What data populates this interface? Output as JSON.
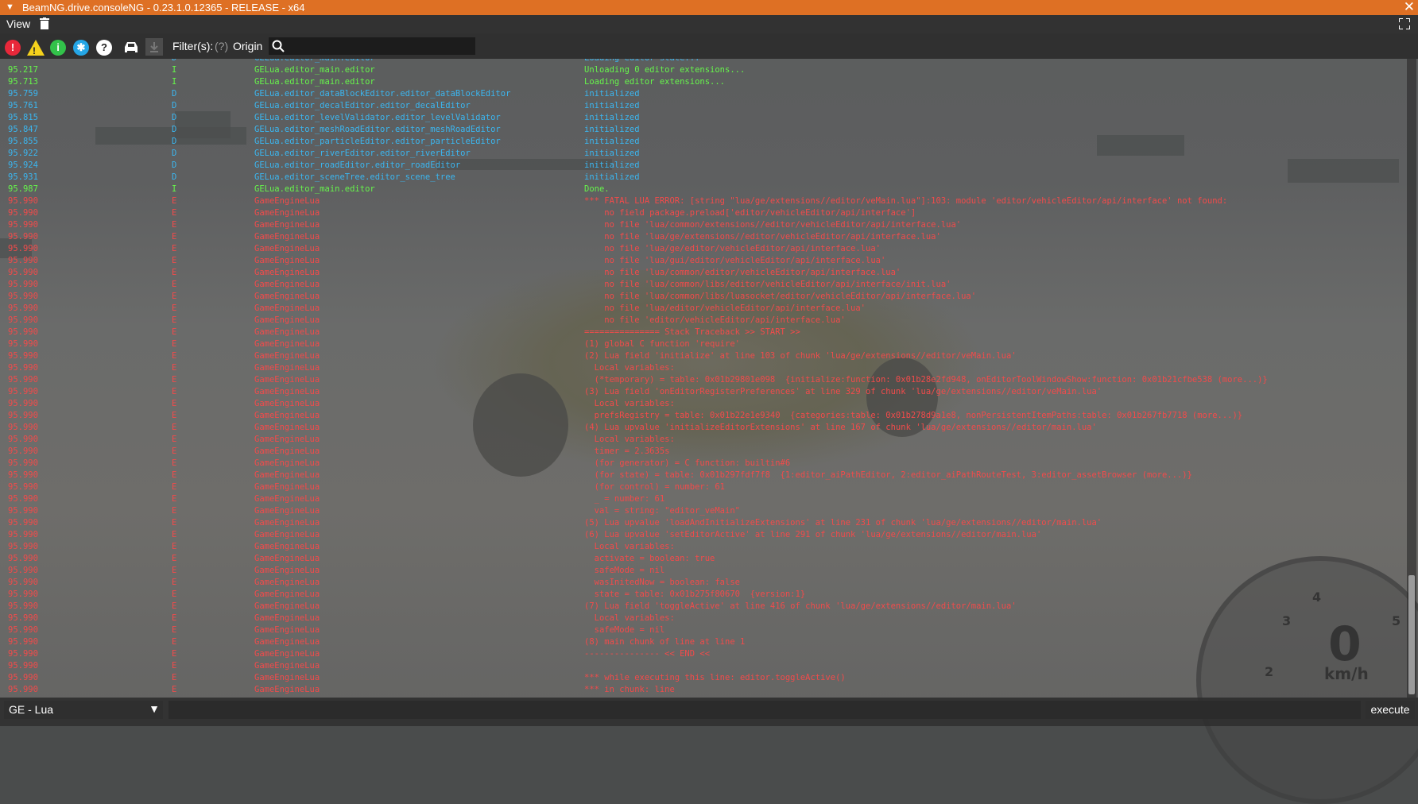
{
  "window": {
    "title": "BeamNG.drive.consoleNG - 0.23.1.0.12365 - RELEASE - x64"
  },
  "menu": {
    "view_label": "View"
  },
  "toolbar": {
    "filter_label": "Filter(s):",
    "filter_hint": "(?)",
    "origin_label": "Origin",
    "search_value": ""
  },
  "gauge": {
    "numbers": [
      "4",
      "3",
      "5",
      "2"
    ],
    "speed": "0",
    "unit": "km/h"
  },
  "log": {
    "rows": [
      {
        "t": "",
        "l": "D",
        "o": "GELua.editor_main.editor",
        "m": "Loading editor state..."
      },
      {
        "t": "95.217",
        "l": "I",
        "o": "GELua.editor_main.editor",
        "m": "Unloading 0 editor extensions..."
      },
      {
        "t": "95.713",
        "l": "I",
        "o": "GELua.editor_main.editor",
        "m": "Loading editor extensions..."
      },
      {
        "t": "95.759",
        "l": "D",
        "o": "GELua.editor_dataBlockEditor.editor_dataBlockEditor",
        "m": "initialized"
      },
      {
        "t": "95.761",
        "l": "D",
        "o": "GELua.editor_decalEditor.editor_decalEditor",
        "m": "initialized"
      },
      {
        "t": "95.815",
        "l": "D",
        "o": "GELua.editor_levelValidator.editor_levelValidator",
        "m": "initialized"
      },
      {
        "t": "95.847",
        "l": "D",
        "o": "GELua.editor_meshRoadEditor.editor_meshRoadEditor",
        "m": "initialized"
      },
      {
        "t": "95.855",
        "l": "D",
        "o": "GELua.editor_particleEditor.editor_particleEditor",
        "m": "initialized"
      },
      {
        "t": "95.922",
        "l": "D",
        "o": "GELua.editor_riverEditor.editor_riverEditor",
        "m": "initialized"
      },
      {
        "t": "95.924",
        "l": "D",
        "o": "GELua.editor_roadEditor.editor_roadEditor",
        "m": "initialized"
      },
      {
        "t": "95.931",
        "l": "D",
        "o": "GELua.editor_sceneTree.editor_scene_tree",
        "m": "initialized"
      },
      {
        "t": "95.987",
        "l": "I",
        "o": "GELua.editor_main.editor",
        "m": "Done."
      },
      {
        "t": "95.990",
        "l": "E",
        "o": "GameEngineLua",
        "m": "*** FATAL LUA ERROR: [string \"lua/ge/extensions//editor/veMain.lua\"]:103: module 'editor/vehicleEditor/api/interface' not found:"
      },
      {
        "t": "95.990",
        "l": "E",
        "o": "GameEngineLua",
        "m": "    no field package.preload['editor/vehicleEditor/api/interface']"
      },
      {
        "t": "95.990",
        "l": "E",
        "o": "GameEngineLua",
        "m": "    no file 'lua/common/extensions//editor/vehicleEditor/api/interface.lua'"
      },
      {
        "t": "95.990",
        "l": "E",
        "o": "GameEngineLua",
        "m": "    no file 'lua/ge/extensions//editor/vehicleEditor/api/interface.lua'"
      },
      {
        "t": "95.990",
        "l": "E",
        "o": "GameEngineLua",
        "m": "    no file 'lua/ge/editor/vehicleEditor/api/interface.lua'"
      },
      {
        "t": "95.990",
        "l": "E",
        "o": "GameEngineLua",
        "m": "    no file 'lua/gui/editor/vehicleEditor/api/interface.lua'"
      },
      {
        "t": "95.990",
        "l": "E",
        "o": "GameEngineLua",
        "m": "    no file 'lua/common/editor/vehicleEditor/api/interface.lua'"
      },
      {
        "t": "95.990",
        "l": "E",
        "o": "GameEngineLua",
        "m": "    no file 'lua/common/libs/editor/vehicleEditor/api/interface/init.lua'"
      },
      {
        "t": "95.990",
        "l": "E",
        "o": "GameEngineLua",
        "m": "    no file 'lua/common/libs/luasocket/editor/vehicleEditor/api/interface.lua'"
      },
      {
        "t": "95.990",
        "l": "E",
        "o": "GameEngineLua",
        "m": "    no file 'lua/editor/vehicleEditor/api/interface.lua'"
      },
      {
        "t": "95.990",
        "l": "E",
        "o": "GameEngineLua",
        "m": "    no file 'editor/vehicleEditor/api/interface.lua'"
      },
      {
        "t": "95.990",
        "l": "E",
        "o": "GameEngineLua",
        "m": "=============== Stack Traceback >> START >>"
      },
      {
        "t": "95.990",
        "l": "E",
        "o": "GameEngineLua",
        "m": "(1) global C function 'require'"
      },
      {
        "t": "95.990",
        "l": "E",
        "o": "GameEngineLua",
        "m": "(2) Lua field 'initialize' at line 103 of chunk 'lua/ge/extensions//editor/veMain.lua'"
      },
      {
        "t": "95.990",
        "l": "E",
        "o": "GameEngineLua",
        "m": "  Local variables:"
      },
      {
        "t": "95.990",
        "l": "E",
        "o": "GameEngineLua",
        "m": "  (*temporary) = table: 0x01b29801e098  {initialize:function: 0x01b28e2fd948, onEditorToolWindowShow:function: 0x01b21cfbe538 (more...)}"
      },
      {
        "t": "95.990",
        "l": "E",
        "o": "GameEngineLua",
        "m": "(3) Lua field 'onEditorRegisterPreferences' at line 329 of chunk 'lua/ge/extensions//editor/veMain.lua'"
      },
      {
        "t": "95.990",
        "l": "E",
        "o": "GameEngineLua",
        "m": "  Local variables:"
      },
      {
        "t": "95.990",
        "l": "E",
        "o": "GameEngineLua",
        "m": "  prefsRegistry = table: 0x01b22e1e9340  {categories:table: 0x01b278d9a1e8, nonPersistentItemPaths:table: 0x01b267fb7718 (more...)}"
      },
      {
        "t": "95.990",
        "l": "E",
        "o": "GameEngineLua",
        "m": "(4) Lua upvalue 'initializeEditorExtensions' at line 167 of chunk 'lua/ge/extensions//editor/main.lua'"
      },
      {
        "t": "95.990",
        "l": "E",
        "o": "GameEngineLua",
        "m": "  Local variables:"
      },
      {
        "t": "95.990",
        "l": "E",
        "o": "GameEngineLua",
        "m": "  timer = 2.3635s"
      },
      {
        "t": "95.990",
        "l": "E",
        "o": "GameEngineLua",
        "m": "  (for generator) = C function: builtin#6"
      },
      {
        "t": "95.990",
        "l": "E",
        "o": "GameEngineLua",
        "m": "  (for state) = table: 0x01b297fdf7f8  {1:editor_aiPathEditor, 2:editor_aiPathRouteTest, 3:editor_assetBrowser (more...)}"
      },
      {
        "t": "95.990",
        "l": "E",
        "o": "GameEngineLua",
        "m": "  (for control) = number: 61"
      },
      {
        "t": "95.990",
        "l": "E",
        "o": "GameEngineLua",
        "m": "  _ = number: 61"
      },
      {
        "t": "95.990",
        "l": "E",
        "o": "GameEngineLua",
        "m": "  val = string: \"editor_veMain\""
      },
      {
        "t": "95.990",
        "l": "E",
        "o": "GameEngineLua",
        "m": "(5) Lua upvalue 'loadAndInitializeExtensions' at line 231 of chunk 'lua/ge/extensions//editor/main.lua'"
      },
      {
        "t": "95.990",
        "l": "E",
        "o": "GameEngineLua",
        "m": "(6) Lua upvalue 'setEditorActive' at line 291 of chunk 'lua/ge/extensions//editor/main.lua'"
      },
      {
        "t": "95.990",
        "l": "E",
        "o": "GameEngineLua",
        "m": "  Local variables:"
      },
      {
        "t": "95.990",
        "l": "E",
        "o": "GameEngineLua",
        "m": "  activate = boolean: true"
      },
      {
        "t": "95.990",
        "l": "E",
        "o": "GameEngineLua",
        "m": "  safeMode = nil"
      },
      {
        "t": "95.990",
        "l": "E",
        "o": "GameEngineLua",
        "m": "  wasInitedNow = boolean: false"
      },
      {
        "t": "95.990",
        "l": "E",
        "o": "GameEngineLua",
        "m": "  state = table: 0x01b275f80670  {version:1}"
      },
      {
        "t": "95.990",
        "l": "E",
        "o": "GameEngineLua",
        "m": "(7) Lua field 'toggleActive' at line 416 of chunk 'lua/ge/extensions//editor/main.lua'"
      },
      {
        "t": "95.990",
        "l": "E",
        "o": "GameEngineLua",
        "m": "  Local variables:"
      },
      {
        "t": "95.990",
        "l": "E",
        "o": "GameEngineLua",
        "m": "  safeMode = nil"
      },
      {
        "t": "95.990",
        "l": "E",
        "o": "GameEngineLua",
        "m": "(8) main chunk of line at line 1"
      },
      {
        "t": "95.990",
        "l": "E",
        "o": "GameEngineLua",
        "m": "--------------- << END <<"
      },
      {
        "t": "95.990",
        "l": "E",
        "o": "GameEngineLua",
        "m": ""
      },
      {
        "t": "95.990",
        "l": "E",
        "o": "GameEngineLua",
        "m": "*** while executing this line: editor.toggleActive()"
      },
      {
        "t": "95.990",
        "l": "E",
        "o": "GameEngineLua",
        "m": "*** in chunk: line"
      }
    ]
  },
  "bottom": {
    "context_label": "GE - Lua",
    "command_value": "",
    "execute_label": "execute"
  },
  "colors": {
    "titlebar": "#de7024",
    "debug": "#3bb6f0",
    "info": "#66f54b",
    "error": "#f24b4b"
  },
  "icons": [
    "menu-triangle-icon",
    "close-icon",
    "trash-icon",
    "fullscreen-icon",
    "error-filter-icon",
    "warning-filter-icon",
    "info-filter-icon",
    "debug-filter-icon",
    "help-icon",
    "car-icon",
    "download-icon",
    "search-icon",
    "dropdown-arrow-icon"
  ]
}
